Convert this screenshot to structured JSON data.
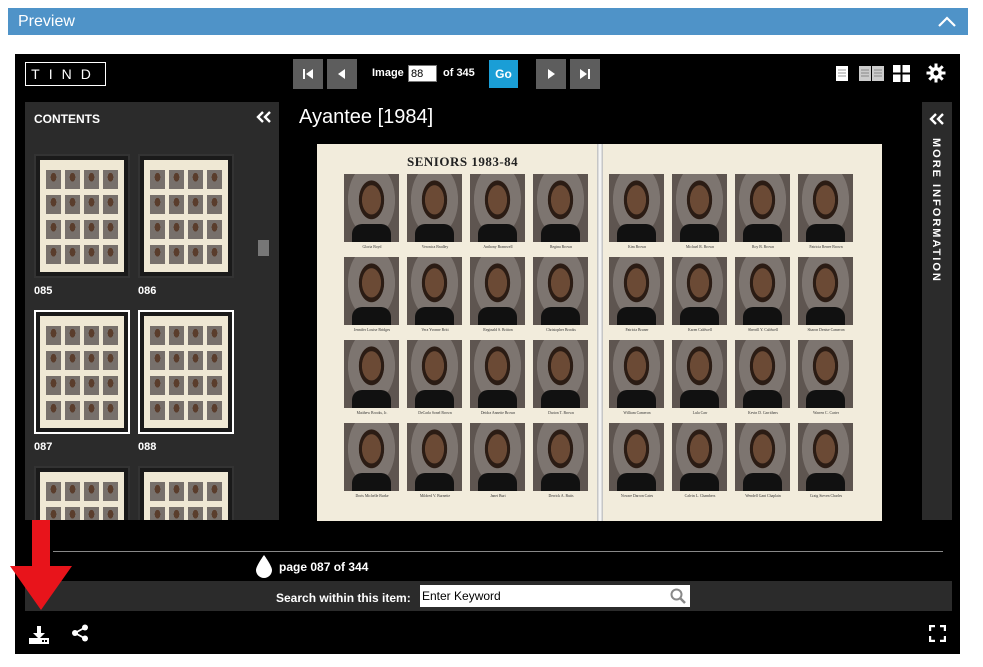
{
  "preview": {
    "title": "Preview"
  },
  "toolbar": {
    "logo": "TIND",
    "image_label": "Image",
    "image_value": "88",
    "of_label": "of 345",
    "go_label": "Go"
  },
  "contents": {
    "header": "CONTENTS",
    "thumbnails": [
      {
        "label": "085"
      },
      {
        "label": "086"
      },
      {
        "label": "087"
      },
      {
        "label": "088"
      }
    ]
  },
  "document": {
    "title": "Ayantee [1984]",
    "page_heading": "SENIORS 1983-84",
    "left_captions": [
      "Gloria Boyd",
      "Veronica Bradley",
      "Anthony Bramwell",
      "Regina Brown",
      "Jennifer Louise Bridges",
      "Vera Yvonne Britt",
      "Reginald S. Britton",
      "Christopher Brooks",
      "Matthew Brooks, Jr.",
      "DeCarla Sonel Brown",
      "Deidra Annette Brown",
      "Darion T. Brown",
      "Doris Michelle Burke",
      "Mildred V. Burnette",
      "Janet Burt",
      "Derrick A. Butts"
    ],
    "right_captions": [
      "Kim Brown",
      "Michael R. Brown",
      "Roy B. Brown",
      "Patricia Renee Brown",
      "Patricia Bruner",
      "Karen Caldwell",
      "Sherrill Y. Caldwell",
      "Sharon Denise Cameron",
      "William Cameron",
      "Lula Carr",
      "Kevin D. Carrithers",
      "Warren C. Carter",
      "Novare Darron Cates",
      "Calvin L. Chambers",
      "Wendell Gant Chaplain",
      "Craig Steven Charles"
    ]
  },
  "more_info": {
    "label": "MORE INFORMATION"
  },
  "pager": {
    "label": "page 087 of 344"
  },
  "search": {
    "label": "Search within this item:",
    "placeholder": "Enter Keyword"
  },
  "colors": {
    "header_blue": "#4f93c8",
    "go_blue": "#1a9ed6",
    "arrow_red": "#e8141b"
  }
}
